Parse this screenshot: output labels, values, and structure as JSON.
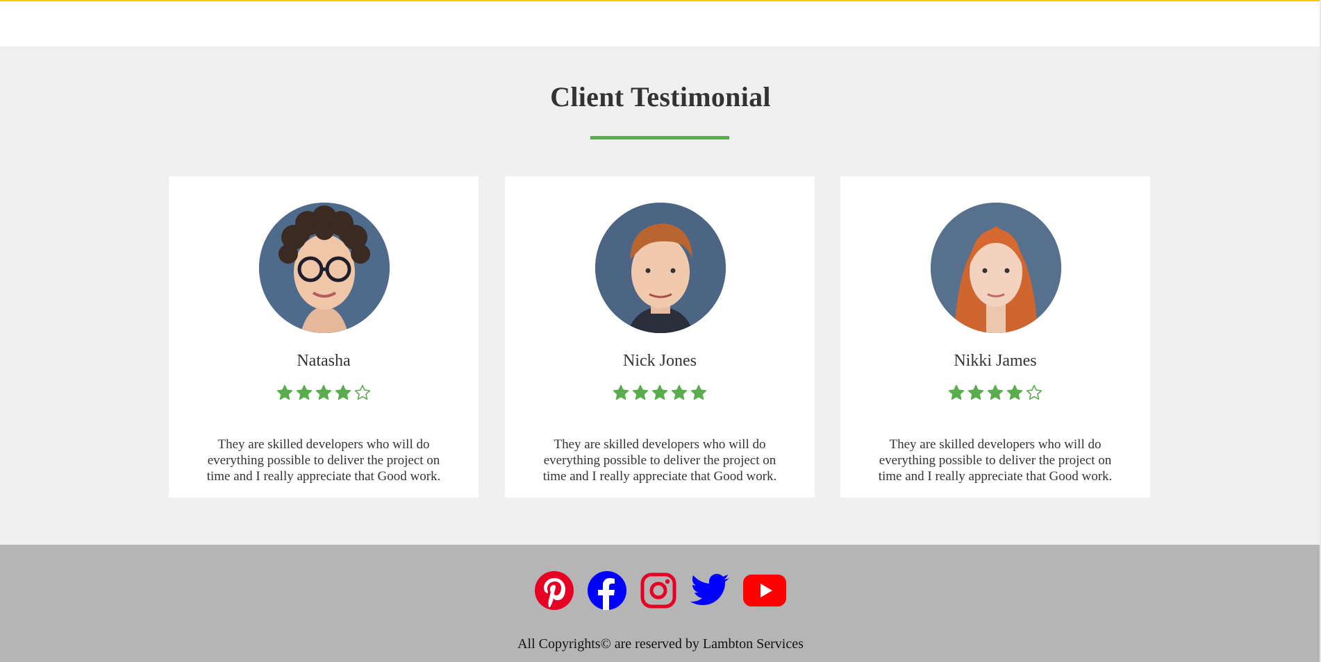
{
  "section": {
    "title": "Client Testimonial"
  },
  "colors": {
    "accent_green": "#5aac4e",
    "top_border": "#f4d000",
    "pinterest": "#e60023",
    "facebook": "#0000ff",
    "instagram": "#e60023",
    "twitter": "#0000ff",
    "youtube": "#ff0000"
  },
  "testimonials": [
    {
      "name": "Natasha",
      "rating": 4,
      "max_rating": 5,
      "quote": "They are skilled developers who will do everything possible to deliver the project on time and I really appreciate that Good work."
    },
    {
      "name": "Nick Jones",
      "rating": 5,
      "max_rating": 5,
      "quote": "They are skilled developers who will do everything possible to deliver the project on time and I really appreciate that Good work."
    },
    {
      "name": "Nikki James",
      "rating": 4,
      "max_rating": 5,
      "quote": "They are skilled developers who will do everything possible to deliver the project on time and I really appreciate that Good work."
    }
  ],
  "footer": {
    "social_icons": [
      "pinterest-icon",
      "facebook-icon",
      "instagram-icon",
      "twitter-icon",
      "youtube-icon"
    ],
    "copyright": "All Copyrights© are reserved by Lambton Services"
  }
}
